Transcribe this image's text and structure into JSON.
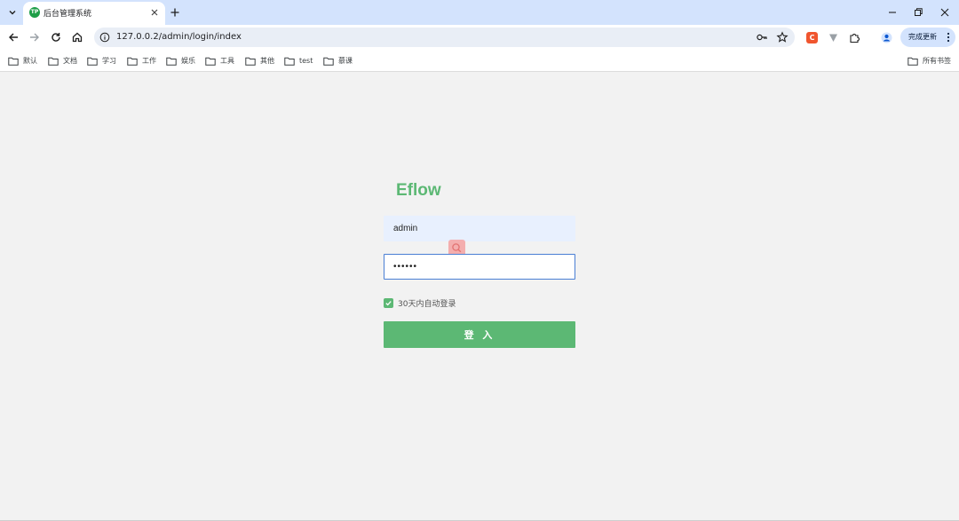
{
  "browser": {
    "tab": {
      "favicon_text": "TP",
      "title": "后台管理系统"
    },
    "address_bar": {
      "url": "127.0.0.2/admin/login/index"
    },
    "extensions": {
      "c_extension_letter": "C"
    },
    "update_button": {
      "label": "完成更新"
    },
    "bookmarks": [
      "默认",
      "文档",
      "学习",
      "工作",
      "娱乐",
      "工具",
      "其他",
      "test",
      "慕课"
    ],
    "all_bookmarks_label": "所有书签",
    "icons": {
      "tab_search": "chevron-down-icon",
      "tab_close": "close-icon",
      "new_tab": "plus-icon",
      "back": "arrow-left-icon",
      "forward": "arrow-right-icon",
      "reload": "reload-icon",
      "home": "home-icon",
      "site_info": "info-icon",
      "password": "key-icon",
      "bookmark_star": "star-icon",
      "extensions": "puzzle-icon",
      "profile": "person-icon"
    }
  },
  "login": {
    "title": "Eflow",
    "username_value": "admin",
    "password_value": "••••••",
    "remember_checked": true,
    "remember_label": "30天内自动登录",
    "submit_label": "登 入"
  },
  "colors": {
    "accent": "#5cb874",
    "tabstrip": "#d3e3fd",
    "page_background": "#f2f2f2",
    "focus_border": "#4a7fd4",
    "autofill_background": "#e8f0fe"
  }
}
